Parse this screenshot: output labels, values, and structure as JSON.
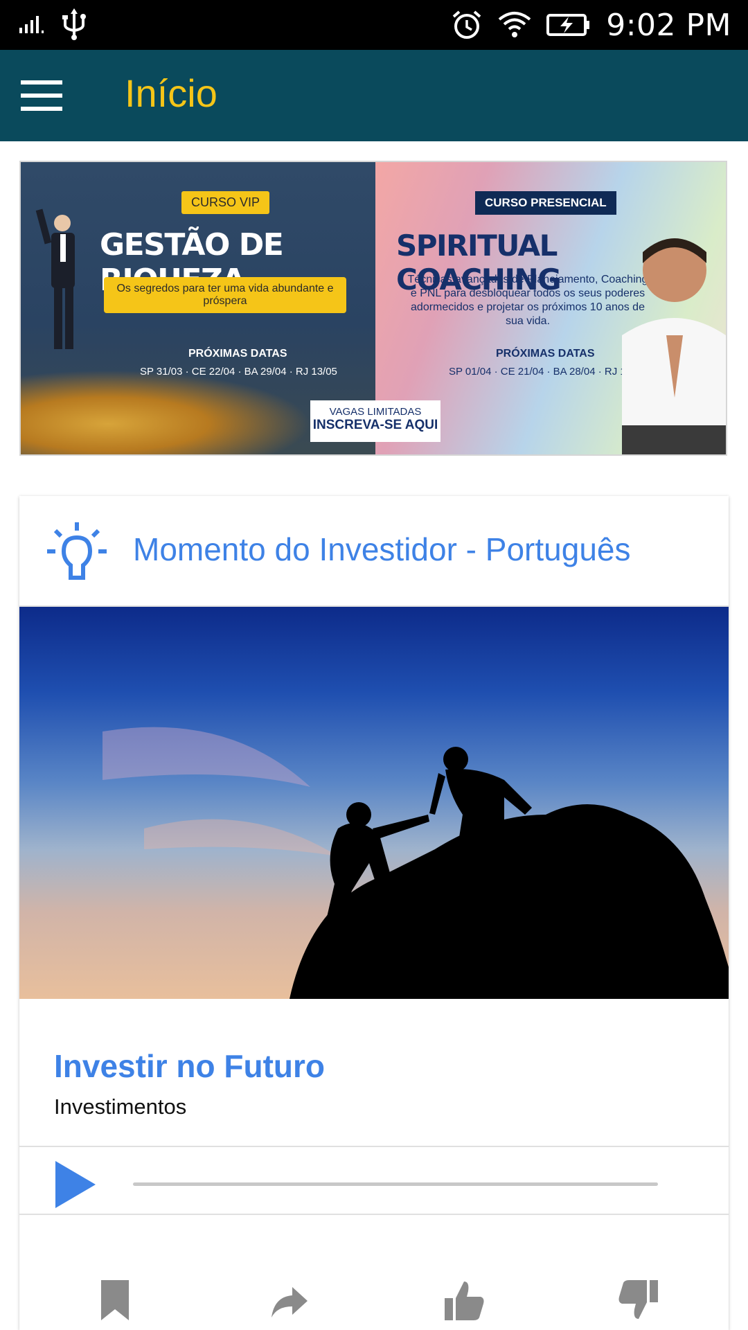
{
  "status_bar": {
    "time": "9:02 PM",
    "icons": [
      "signal-icon",
      "usb-icon",
      "alarm-icon",
      "wifi-icon",
      "battery-charging-icon"
    ]
  },
  "app_bar": {
    "title": "Início",
    "menu_icon": "hamburger-menu-icon",
    "background": "#0a4a5c",
    "title_color": "#f5c518"
  },
  "banner": {
    "left": {
      "badge": "CURSO VIP",
      "title": "GESTÃO DE RIQUEZA",
      "subtitle": "Os segredos para ter uma vida abundante e próspera",
      "dates_heading": "PRÓXIMAS DATAS",
      "dates": "SP 31/03 · CE 22/04 · BA 29/04 · RJ 13/05"
    },
    "right": {
      "badge": "CURSO PRESENCIAL",
      "title": "SPIRITUAL COACHING",
      "description": "Técnicas avançadas de Planejamento, Coaching e PNL para desbloquear todos os seus poderes adormecidos e projetar os próximos 10 anos de sua vida.",
      "dates_heading": "PRÓXIMAS DATAS",
      "dates": "SP 01/04 · CE 21/04 · BA 28/04 · RJ 12/05"
    },
    "cta": {
      "small": "VAGAS LIMITADAS",
      "big": "INSCREVA-SE AQUI"
    }
  },
  "card": {
    "header_icon": "lightbulb-icon",
    "header_title": "Momento do Investidor - Português",
    "title": "Investir no Futuro",
    "category": "Investimentos",
    "player": {
      "play_icon": "play-icon",
      "progress": 0
    },
    "actions": [
      {
        "icon": "bookmark-icon"
      },
      {
        "icon": "share-icon"
      },
      {
        "icon": "thumbs-up-icon"
      },
      {
        "icon": "thumbs-down-icon"
      }
    ],
    "accent": "#3e82e6"
  }
}
